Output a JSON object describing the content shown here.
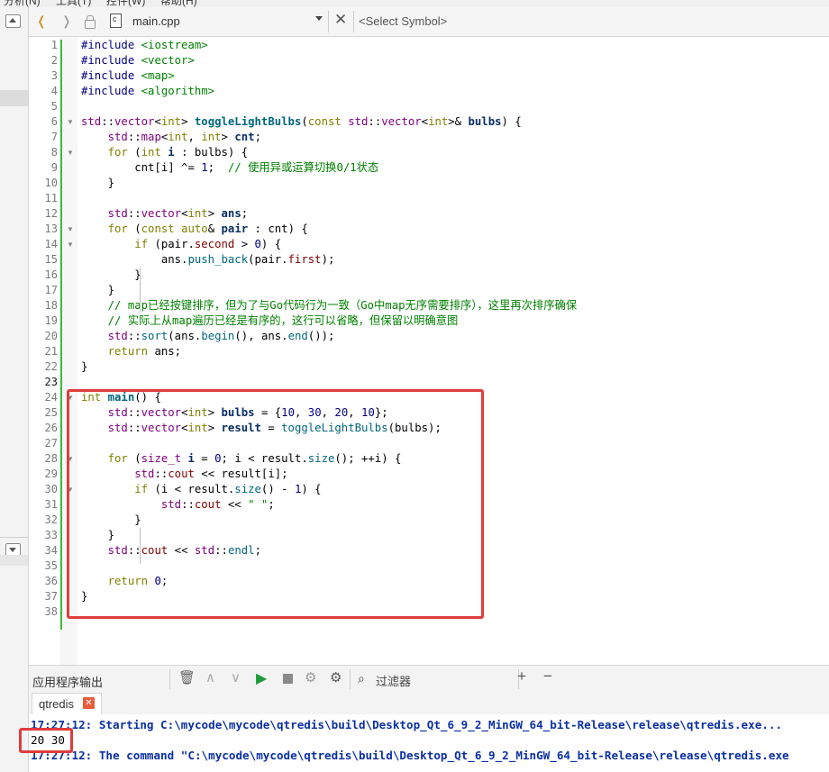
{
  "menubar": {
    "items": [
      "分析(N)",
      "工具(T)",
      "控件(W)",
      "帮助(H)"
    ]
  },
  "toolbar": {
    "file_name": "main.cpp",
    "symbol_placeholder": "<Select Symbol>"
  },
  "editor": {
    "current_line": 23,
    "lines": [
      {
        "n": "1",
        "html": "<span class=\"pp\">#include</span> <span class=\"inc\">&lt;iostream&gt;</span>"
      },
      {
        "n": "2",
        "html": "<span class=\"pp\">#include</span> <span class=\"inc\">&lt;vector&gt;</span>"
      },
      {
        "n": "3",
        "html": "<span class=\"pp\">#include</span> <span class=\"inc\">&lt;map&gt;</span>"
      },
      {
        "n": "4",
        "html": "<span class=\"pp\">#include</span> <span class=\"inc\">&lt;algorithm&gt;</span>"
      },
      {
        "n": "5",
        "html": ""
      },
      {
        "n": "6",
        "fold": true,
        "html": "<span class=\"ty\">std</span>::<span class=\"ty\">vector</span>&lt;<span class=\"kw\">int</span>&gt; <span class=\"fnd\">toggleLightBulbs</span>(<span class=\"kw\">const</span> <span class=\"ty\">std</span>::<span class=\"ty\">vector</span>&lt;<span class=\"kw\">int</span>&gt;&amp; <span class=\"vb\">bulbs</span>) {"
      },
      {
        "n": "7",
        "html": "    <span class=\"ty\">std</span>::<span class=\"ty\">map</span>&lt;<span class=\"kw\">int</span>, <span class=\"kw\">int</span>&gt; <span class=\"vb\">cnt</span>;"
      },
      {
        "n": "8",
        "fold": true,
        "html": "    <span class=\"kw\">for</span> (<span class=\"kw\">int</span> <span class=\"vb\">i</span> : bulbs) {"
      },
      {
        "n": "9",
        "html": "        cnt[i] ^= <span class=\"num\">1</span>;  <span class=\"cm\">// 使用异或运算切换0/1状态</span>"
      },
      {
        "n": "10",
        "html": "    }"
      },
      {
        "n": "11",
        "html": ""
      },
      {
        "n": "12",
        "html": "    <span class=\"ty\">std</span>::<span class=\"ty\">vector</span>&lt;<span class=\"kw\">int</span>&gt; <span class=\"vb\">ans</span>;"
      },
      {
        "n": "13",
        "fold": true,
        "html": "    <span class=\"kw\">for</span> (<span class=\"kw\">const</span> <span class=\"kw\">auto</span>&amp; <span class=\"vb\">pair</span> : cnt) {"
      },
      {
        "n": "14",
        "fold": true,
        "html": "        <span class=\"kw\">if</span> (pair.<span class=\"mem\">second</span> &gt; <span class=\"num\">0</span>) {"
      },
      {
        "n": "15",
        "html": "            ans.<span class=\"fn\">push_back</span>(pair.<span class=\"mem\">first</span>);"
      },
      {
        "n": "16",
        "html": "        }"
      },
      {
        "n": "17",
        "html": "    }"
      },
      {
        "n": "18",
        "html": "    <span class=\"cm\">// map已经按键排序，但为了与Go代码行为一致（Go中map无序需要排序），这里再次排序确保</span>"
      },
      {
        "n": "19",
        "html": "    <span class=\"cm\">// 实际上从map遍历已经是有序的，这行可以省略，但保留以明确意图</span>"
      },
      {
        "n": "20",
        "html": "    <span class=\"ty\">std</span>::<span class=\"fn\">sort</span>(ans.<span class=\"fn\">begin</span>(), ans.<span class=\"fn\">end</span>());"
      },
      {
        "n": "21",
        "html": "    <span class=\"kw\">return</span> ans;"
      },
      {
        "n": "22",
        "html": "}"
      },
      {
        "n": "23",
        "html": ""
      },
      {
        "n": "24",
        "fold": true,
        "html": "<span class=\"kw\">int</span> <span class=\"fnd\">main</span>() {"
      },
      {
        "n": "25",
        "html": "    <span class=\"ty\">std</span>::<span class=\"ty\">vector</span>&lt;<span class=\"kw\">int</span>&gt; <span class=\"vb\">bulbs</span> = {<span class=\"num\">10</span>, <span class=\"num\">30</span>, <span class=\"num\">20</span>, <span class=\"num\">10</span>};"
      },
      {
        "n": "26",
        "html": "    <span class=\"ty\">std</span>::<span class=\"ty\">vector</span>&lt;<span class=\"kw\">int</span>&gt; <span class=\"vb\">result</span> = <span class=\"fn\">toggleLightBulbs</span>(bulbs);"
      },
      {
        "n": "27",
        "html": ""
      },
      {
        "n": "28",
        "fold": true,
        "html": "    <span class=\"kw\">for</span> (<span class=\"ty\">size_t</span> <span class=\"vb\">i</span> = <span class=\"num\">0</span>; i &lt; result.<span class=\"fn\">size</span>(); ++i) {"
      },
      {
        "n": "29",
        "html": "        <span class=\"ty\">std</span>::<span class=\"mem\">cout</span> &lt;&lt; result[i];"
      },
      {
        "n": "30",
        "fold": true,
        "html": "        <span class=\"kw\">if</span> (i &lt; result.<span class=\"fn\">size</span>() - <span class=\"num\">1</span>) {"
      },
      {
        "n": "31",
        "html": "            <span class=\"ty\">std</span>::<span class=\"mem\">cout</span> &lt;&lt; <span class=\"str\">\" \"</span>;"
      },
      {
        "n": "32",
        "html": "        }"
      },
      {
        "n": "33",
        "html": "    }"
      },
      {
        "n": "34",
        "html": "    <span class=\"ty\">std</span>::<span class=\"mem\">cout</span> &lt;&lt; <span class=\"ty\">std</span>::<span class=\"fn\">endl</span>;"
      },
      {
        "n": "35",
        "html": ""
      },
      {
        "n": "36",
        "html": "    <span class=\"kw\">return</span> <span class=\"num\">0</span>;"
      },
      {
        "n": "37",
        "html": "}"
      },
      {
        "n": "38",
        "html": ""
      }
    ]
  },
  "output": {
    "title": "应用程序输出",
    "filter_label": "过滤器",
    "tab_label": "qtredis",
    "lines": [
      {
        "kind": "info",
        "text": "17:27:12: Starting C:\\mycode\\mycode\\qtredis\\build\\Desktop_Qt_6_9_2_MinGW_64_bit-Release\\release\\qtredis.exe..."
      },
      {
        "kind": "plain",
        "text": "20 30"
      },
      {
        "kind": "info",
        "text": "17:27:12: The command \"C:\\mycode\\mycode\\qtredis\\build\\Desktop_Qt_6_9_2_MinGW_64_bit-Release\\release\\qtredis.exe"
      }
    ]
  },
  "colors": {
    "highlight_border": "#e03c3c",
    "change_bar": "#3fb93f",
    "info_text": "#0a2fa3"
  }
}
